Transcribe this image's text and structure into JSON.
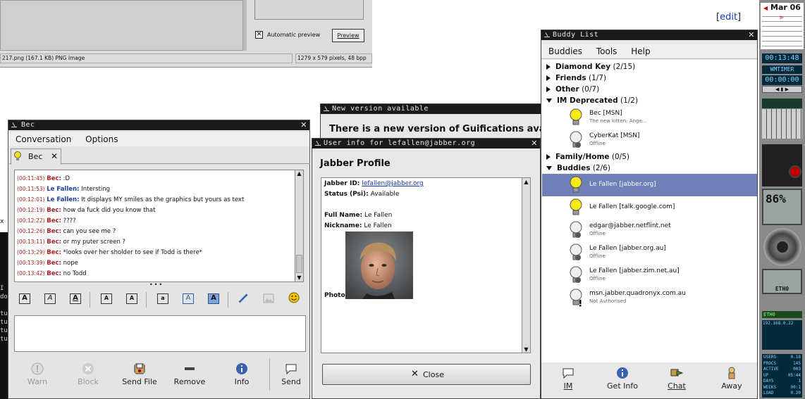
{
  "top_dialog": {
    "auto_preview_label": "Automatic preview",
    "preview_button": "Preview",
    "file_status": "217.png (167.1 KB)  PNG image",
    "image_info": "1279 x 579 pixels, 48 bpp"
  },
  "wiki": {
    "edit_label": "edit"
  },
  "chat": {
    "title": "Bec",
    "menu": [
      "Conversation",
      "Options"
    ],
    "tab_label": "Bec",
    "messages": [
      {
        "time": "(00:11:45)",
        "nick": "Bec:",
        "who": "bec",
        "text": ":D"
      },
      {
        "time": "(00:11:53)",
        "nick": "Le Fallen:",
        "who": "lf",
        "text": "Intersting"
      },
      {
        "time": "(00:12:01)",
        "nick": "Le Fallen:",
        "who": "lf",
        "text": "It displays MY smiles as the graphics but yours as text"
      },
      {
        "time": "(00:12:19)",
        "nick": "Bec:",
        "who": "bec",
        "text": "how da fuck did you know that"
      },
      {
        "time": "(00:12:22)",
        "nick": "Bec:",
        "who": "bec",
        "text": "????"
      },
      {
        "time": "(00:12:26)",
        "nick": "Bec:",
        "who": "bec",
        "text": "can you see me ?"
      },
      {
        "time": "(00:13:11)",
        "nick": "Bec:",
        "who": "bec",
        "text": "or my puter screen ?"
      },
      {
        "time": "(00:13:29)",
        "nick": "Bec:",
        "who": "bec",
        "text": "*looks over her sholder to see if Todd is there*"
      },
      {
        "time": "(00:13:39)",
        "nick": "Bec:",
        "who": "bec",
        "text": "nope"
      },
      {
        "time": "(00:13:42)",
        "nick": "Bec:",
        "who": "bec",
        "text": "no Todd"
      }
    ],
    "buttons": [
      "Warn",
      "Block",
      "Send File",
      "Remove",
      "Info",
      "Send"
    ]
  },
  "new_version": {
    "title": "New version available",
    "message": "There is a new version of Guifications ava"
  },
  "user_info": {
    "title": "User info for lefallen@jabber.org",
    "heading": "Jabber Profile",
    "jabber_id_label": "Jabber ID:",
    "jabber_id": "lefallen@jabber.org",
    "status_label": "Status (Psi):",
    "status": "Available",
    "full_name_label": "Full Name:",
    "full_name": "Le Fallen",
    "nickname_label": "Nickname:",
    "nickname": "Le Fallen",
    "photo_label": "Photo:",
    "close_button": "Close"
  },
  "buddy_list": {
    "title": "Buddy List",
    "menu": [
      "Buddies",
      "Tools",
      "Help"
    ],
    "groups": [
      {
        "name": "Diamond Key",
        "count": "(2/15)"
      },
      {
        "name": "Friends",
        "count": "(1/7)"
      },
      {
        "name": "Other",
        "count": "(0/7)"
      },
      {
        "name": "IM Deprecated",
        "count": "(1/2)"
      },
      {
        "name": "Family/Home",
        "count": "(0/5)"
      },
      {
        "name": "Buddies",
        "count": "(2/6)"
      }
    ],
    "buddies": [
      {
        "name": "Bec [MSN]",
        "status": "The new kitten: Ange..."
      },
      {
        "name": "CyberKat [MSN]",
        "status": "Offline"
      },
      {
        "name": "Le Fallen [jabber.org]",
        "status": ""
      },
      {
        "name": "Le Fallen [talk.google.com]",
        "status": ""
      },
      {
        "name": "edgar@jabber.netflint.net",
        "status": "Offline"
      },
      {
        "name": "Le Fallen [jabber.org.au]",
        "status": "Offline"
      },
      {
        "name": "Le Fallen [jabber.zim.net.au]",
        "status": "Offline"
      },
      {
        "name": "msn.jabber.quadronyx.com.au",
        "status": "Not Authorised"
      }
    ],
    "buttons": [
      "IM",
      "Get Info",
      "Chat",
      "Away"
    ]
  },
  "applets": {
    "date": "Mar 06",
    "clock": "00:13:48",
    "timer_label": "WMTIMER",
    "timer": "00:00:00",
    "cpu": "86%",
    "eth": "ETH0",
    "ip": "192.168.0.22",
    "stats_labels": [
      "USERS",
      "PROCS",
      "ACTIVE",
      "UP",
      "DAYS",
      "WEEKS",
      "LOAD"
    ],
    "stats_values": [
      "0.18",
      "145",
      "003",
      "05:44",
      "1",
      "00:1",
      "0.20"
    ]
  },
  "colors": {
    "selection": "#6f7fb8",
    "bec_nick": "#b02020",
    "lefallen_nick": "#2040a0",
    "titlebar": "#1a1a1a",
    "link": "#1a35b0"
  }
}
